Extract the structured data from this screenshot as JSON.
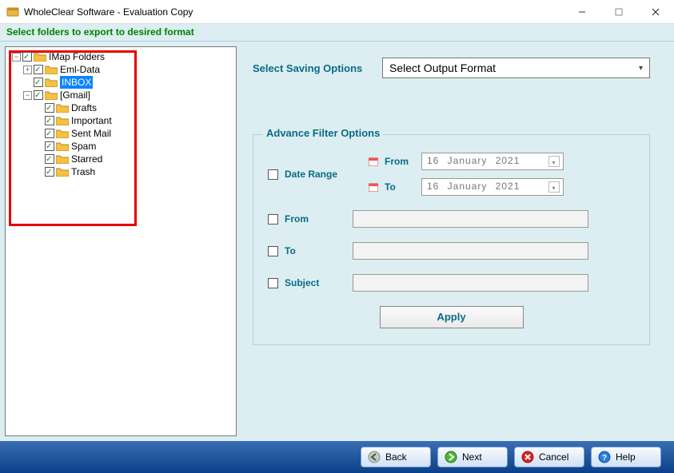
{
  "window": {
    "title": "WholeClear Software - Evaluation Copy"
  },
  "sub_header": "Select folders to export to desired format",
  "tree": {
    "root": "IMap Folders",
    "eml": "Eml-Data",
    "inbox": "INBOX",
    "gmail": "[Gmail]",
    "drafts": "Drafts",
    "important": "Important",
    "sent": "Sent Mail",
    "spam": "Spam",
    "starred": "Starred",
    "trash": "Trash"
  },
  "saving": {
    "label": "Select Saving Options",
    "placeholder": "Select Output Format"
  },
  "filter": {
    "title": "Advance Filter Options",
    "date_range": "Date Range",
    "from_date_label": "From",
    "to_date_label": "To",
    "from_date_value": "16  January   2021",
    "to_date_value": "16  January   2021",
    "from_label": "From",
    "to_label": "To",
    "subject_label": "Subject",
    "apply": "Apply"
  },
  "nav": {
    "back": "Back",
    "next": "Next",
    "cancel": "Cancel",
    "help": "Help"
  }
}
